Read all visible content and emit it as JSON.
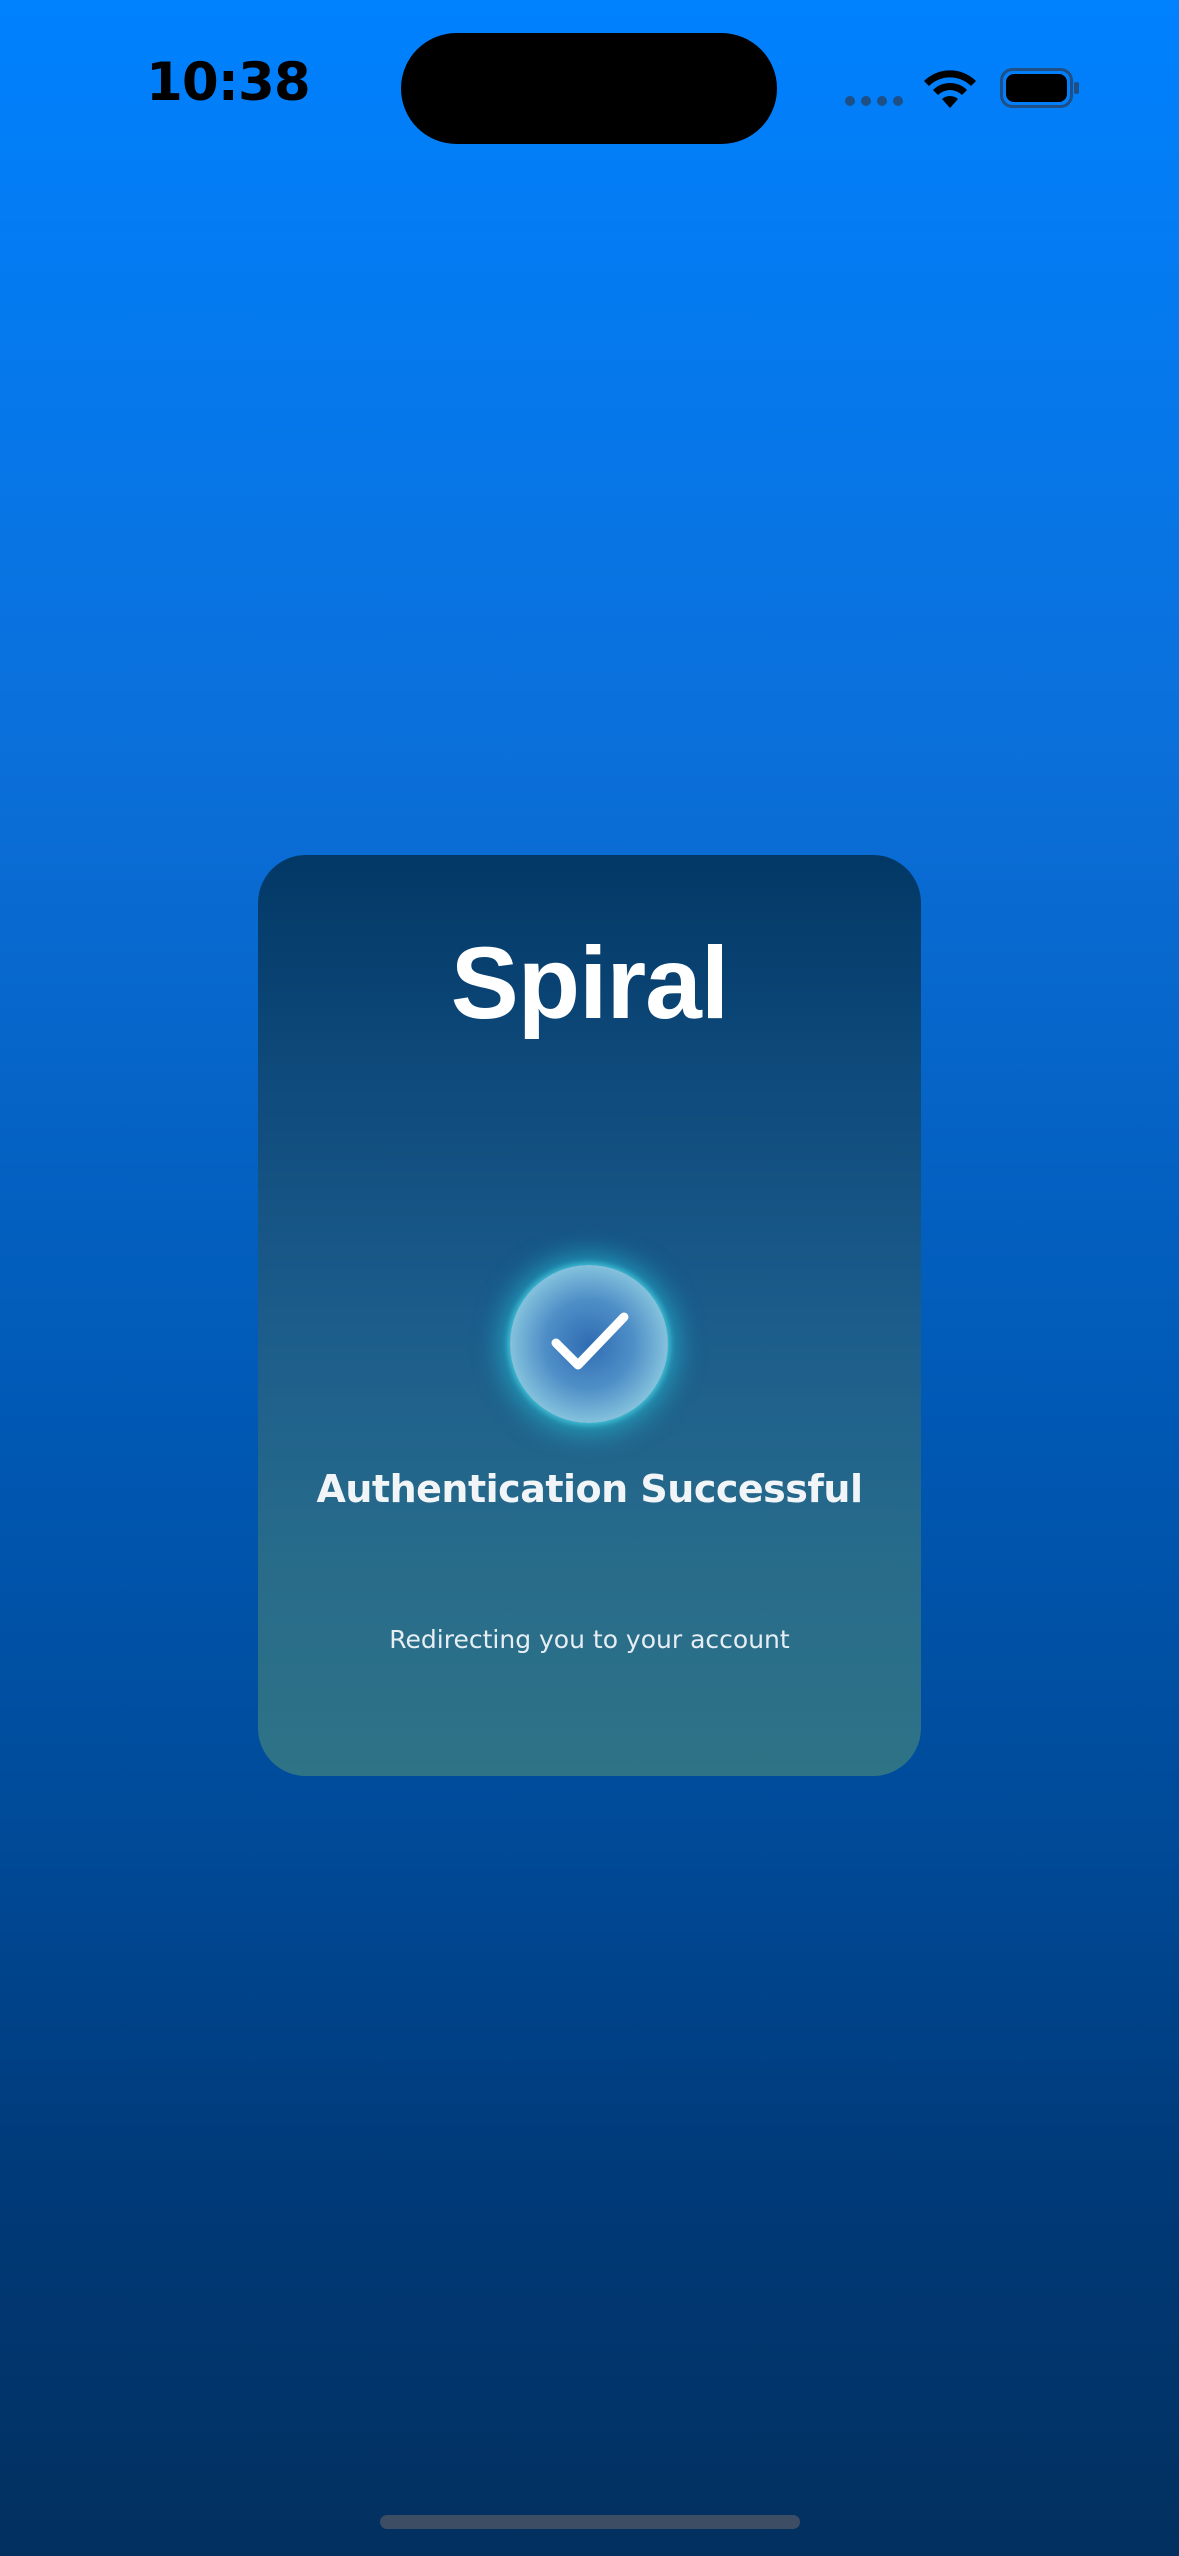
{
  "status_bar": {
    "time": "10:38",
    "icons": [
      "signal-dots-icon",
      "wifi-icon",
      "battery-icon"
    ]
  },
  "card": {
    "app_title": "Spiral",
    "badge_icon": "checkmark-icon",
    "status_heading": "Authentication Successful",
    "status_subtext": "Redirecting you to your account"
  },
  "colors": {
    "background_top": "#0081fe",
    "background_bottom": "#02305f",
    "card_top": "#023866",
    "card_bottom": "#2e7386",
    "badge_glow": "#28d2e6",
    "text_primary": "#ffffff"
  }
}
